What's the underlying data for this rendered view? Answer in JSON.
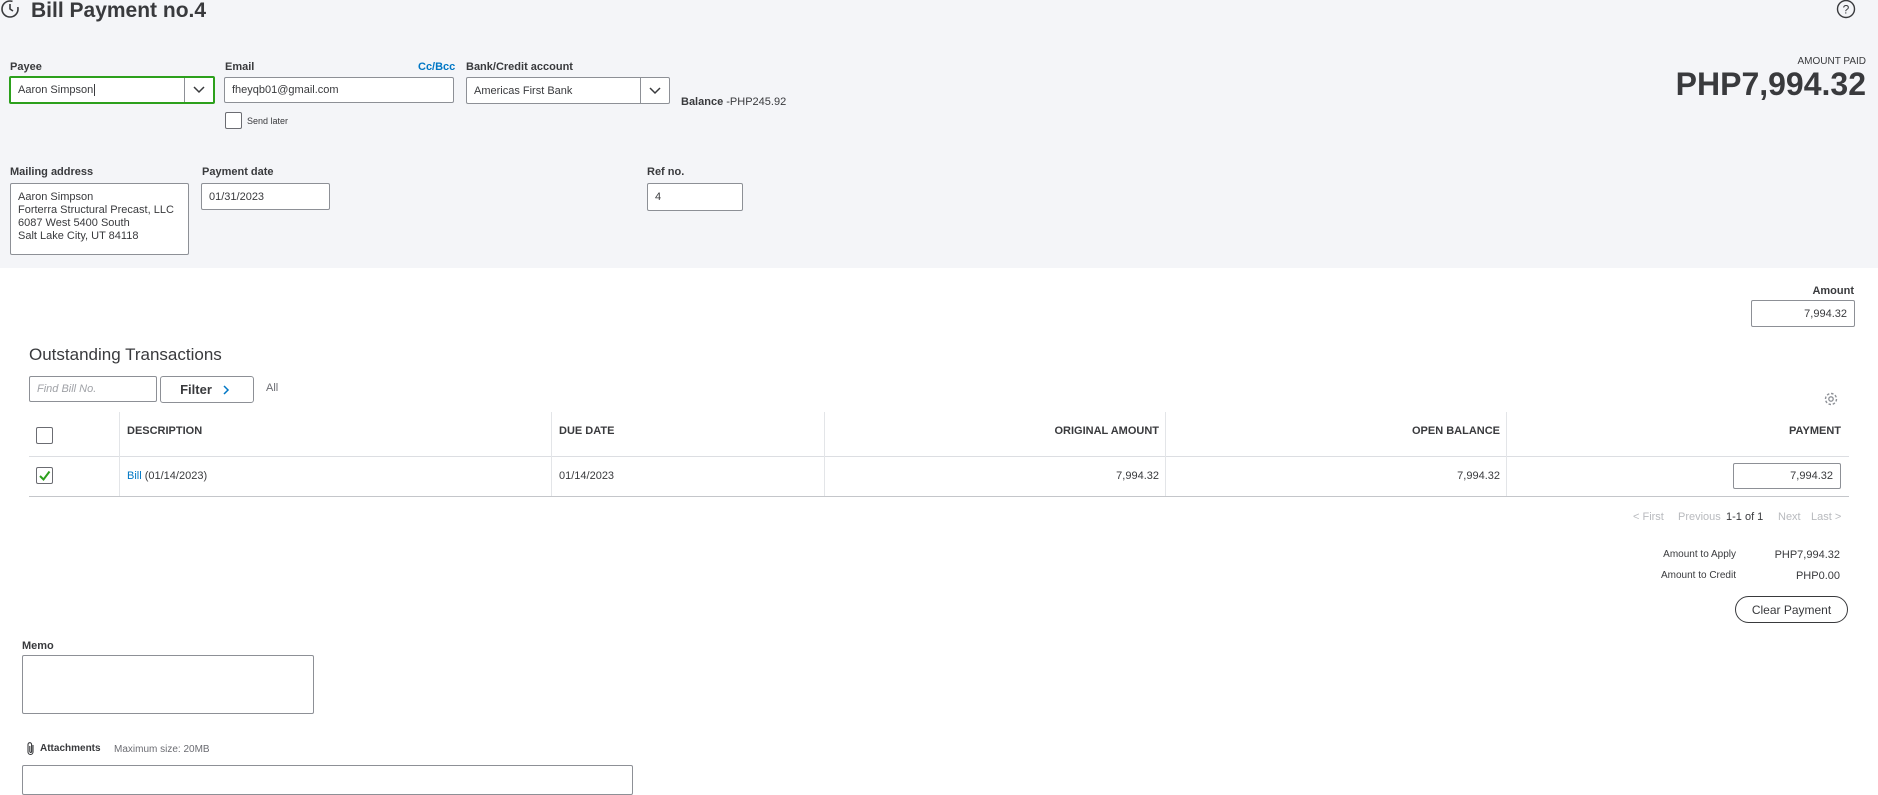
{
  "header": {
    "title": "Bill Payment no.4",
    "amount_paid_label": "AMOUNT PAID",
    "amount_paid_value": "PHP7,994.32"
  },
  "form": {
    "payee_label": "Payee",
    "payee_value": "Aaron Simpson",
    "email_label": "Email",
    "cc_bcc": "Cc/Bcc",
    "email_value": "fheyqb01@gmail.com",
    "send_later_label": "Send later",
    "bank_label": "Bank/Credit account",
    "bank_value": "Americas First Bank",
    "balance_label": "Balance",
    "balance_value": "-PHP245.92",
    "mailing_label": "Mailing address",
    "mailing_lines": [
      "Aaron Simpson",
      "Forterra Structural Precast, LLC",
      "6087 West 5400 South",
      "Salt Lake City, UT  84118"
    ],
    "payment_date_label": "Payment date",
    "payment_date_value": "01/31/2023",
    "ref_label": "Ref no.",
    "ref_value": "4"
  },
  "amount": {
    "label": "Amount",
    "value": "7,994.32"
  },
  "outstanding": {
    "title": "Outstanding Transactions",
    "find_placeholder": "Find Bill No.",
    "filter_label": "Filter",
    "filter_value": "All",
    "columns": [
      "DESCRIPTION",
      "DUE DATE",
      "ORIGINAL AMOUNT",
      "OPEN BALANCE",
      "PAYMENT"
    ],
    "rows": [
      {
        "link": "Bill",
        "desc_rest": " (01/14/2023)",
        "due_date": "01/14/2023",
        "original": "7,994.32",
        "open": "7,994.32",
        "payment": "7,994.32",
        "checked": true
      }
    ],
    "pager": {
      "first": "< First",
      "previous": "Previous",
      "range": "1-1 of 1",
      "next": "Next",
      "last": "Last >"
    }
  },
  "summary": {
    "apply_label": "Amount to Apply",
    "apply_value": "PHP7,994.32",
    "credit_label": "Amount to Credit",
    "credit_value": "PHP0.00",
    "clear_button": "Clear Payment"
  },
  "memo": {
    "label": "Memo"
  },
  "attachments": {
    "label": "Attachments",
    "max_size": "Maximum size: 20MB"
  },
  "icons": {
    "history": "history-icon",
    "help": "help-icon",
    "settings": "gear-icon",
    "attach": "paperclip-icon"
  },
  "colors": {
    "accent_green": "#2ca01c",
    "link_blue": "#0077c5",
    "header_bg": "#f4f5f8"
  }
}
